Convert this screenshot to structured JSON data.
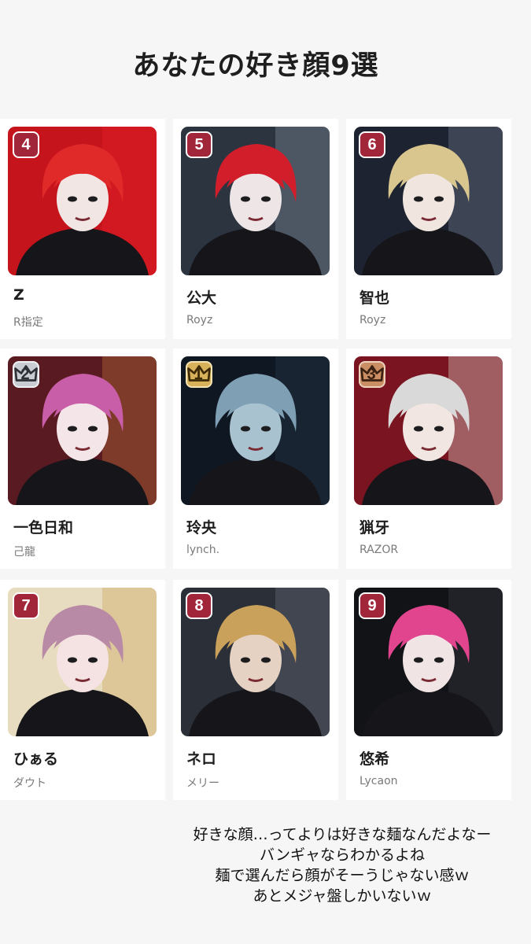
{
  "title": "あなたの好き顔9選",
  "cards": [
    {
      "rank": "4",
      "name": "Z",
      "group": "R指定",
      "bg": "#c6141c",
      "accent": "#e8232a",
      "hair": "#e02a2a",
      "skin": "#f1e6e4",
      "crown": false
    },
    {
      "rank": "5",
      "name": "公大",
      "group": "Royz",
      "bg": "#2c3440",
      "accent": "#8d97a6",
      "hair": "#d21e2b",
      "skin": "#eee6e6",
      "crown": false
    },
    {
      "rank": "6",
      "name": "智也",
      "group": "Royz",
      "bg": "#1d2330",
      "accent": "#7b8496",
      "hair": "#d9c58e",
      "skin": "#f0e6df",
      "crown": false
    },
    {
      "rank": "2",
      "name": "一色日和",
      "group": "己龍",
      "bg": "#5a1a22",
      "accent": "#c47a3a",
      "hair": "#c85ea8",
      "skin": "#f4e5e8",
      "crown": true,
      "tier": "silver"
    },
    {
      "rank": "1",
      "name": "玲央",
      "group": "lynch.",
      "bg": "#0f1722",
      "accent": "#2c3b4e",
      "hair": "#7f9fb4",
      "skin": "#a9c2cf",
      "crown": true,
      "tier": "gold"
    },
    {
      "rank": "3",
      "name": "猟牙",
      "group": "RAZOR",
      "bg": "#7a1420",
      "accent": "#e9e4e0",
      "hair": "#d9d9d9",
      "skin": "#f1e6e2",
      "crown": true,
      "tier": "bronze"
    },
    {
      "rank": "7",
      "name": "ひぁる",
      "group": "ダウト",
      "bg": "#e8dcc0",
      "accent": "#c89e4c",
      "hair": "#b98aa6",
      "skin": "#f4e3e2",
      "crown": false
    },
    {
      "rank": "8",
      "name": "ネロ",
      "group": "メリー",
      "bg": "#2a2f38",
      "accent": "#6d7380",
      "hair": "#caa15a",
      "skin": "#e6d2c2",
      "crown": false
    },
    {
      "rank": "9",
      "name": "悠希",
      "group": "Lycaon",
      "bg": "#111317",
      "accent": "#3b3f46",
      "hair": "#e0458e",
      "skin": "#f0e4e4",
      "crown": false
    }
  ],
  "caption": [
    "好きな顔…ってよりは好きな麺なんだよなー",
    "バンギャならわかるよね",
    "麺で選んだら顔がそーうじゃない感ｗ",
    "あとメジャ盤しかいないｗ"
  ]
}
